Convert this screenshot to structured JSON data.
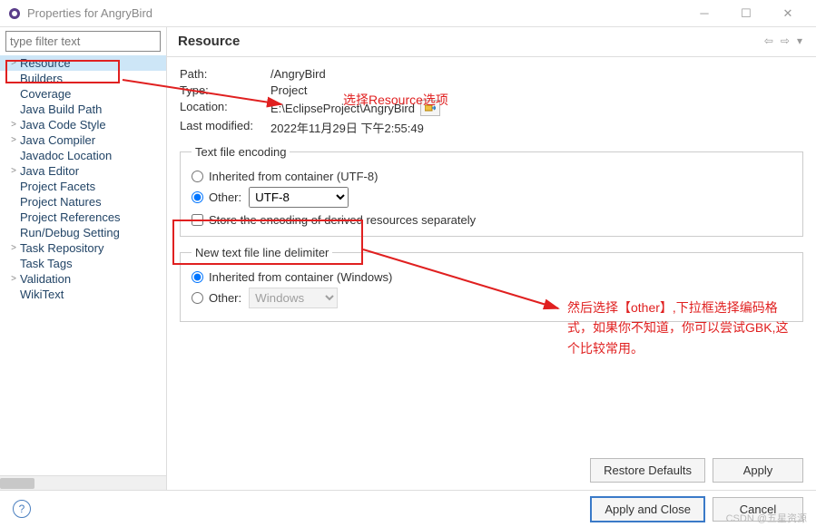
{
  "window": {
    "title": "Properties for AngryBird"
  },
  "filter_placeholder": "type filter text",
  "tree": {
    "items": [
      {
        "label": "Resource",
        "expandable": true,
        "selected": true
      },
      {
        "label": "Builders",
        "expandable": false,
        "selected": false
      },
      {
        "label": "Coverage",
        "expandable": false,
        "selected": false
      },
      {
        "label": "Java Build Path",
        "expandable": false,
        "selected": false
      },
      {
        "label": "Java Code Style",
        "expandable": true,
        "selected": false
      },
      {
        "label": "Java Compiler",
        "expandable": true,
        "selected": false
      },
      {
        "label": "Javadoc Location",
        "expandable": false,
        "selected": false
      },
      {
        "label": "Java Editor",
        "expandable": true,
        "selected": false
      },
      {
        "label": "Project Facets",
        "expandable": false,
        "selected": false
      },
      {
        "label": "Project Natures",
        "expandable": false,
        "selected": false
      },
      {
        "label": "Project References",
        "expandable": false,
        "selected": false
      },
      {
        "label": "Run/Debug Setting",
        "expandable": false,
        "selected": false
      },
      {
        "label": "Task Repository",
        "expandable": true,
        "selected": false
      },
      {
        "label": "Task Tags",
        "expandable": false,
        "selected": false
      },
      {
        "label": "Validation",
        "expandable": true,
        "selected": false
      },
      {
        "label": "WikiText",
        "expandable": false,
        "selected": false
      }
    ]
  },
  "page": {
    "title": "Resource",
    "path_label": "Path:",
    "path_value": "/AngryBird",
    "type_label": "Type:",
    "type_value": "Project",
    "location_label": "Location:",
    "location_value": "E:\\EclipseProject\\AngryBird",
    "modified_label": "Last modified:",
    "modified_value": "2022年11月29日 下午2:55:49",
    "encoding": {
      "legend": "Text file encoding",
      "inherited_label": "Inherited from container (UTF-8)",
      "other_label": "Other:",
      "other_value": "UTF-8",
      "store_label": "Store the encoding of derived resources separately"
    },
    "delimiter": {
      "legend": "New text file line delimiter",
      "inherited_label": "Inherited from container (Windows)",
      "other_label": "Other:",
      "other_value": "Windows"
    }
  },
  "buttons": {
    "restore": "Restore Defaults",
    "apply": "Apply",
    "apply_close": "Apply and Close",
    "cancel": "Cancel"
  },
  "annotations": {
    "note1": "选择Resource选项",
    "note2": "然后选择【other】,下拉框选择编码格式，如果你不知道，你可以尝试GBK,这个比较常用。"
  },
  "watermark": "CSDN @五星资源"
}
